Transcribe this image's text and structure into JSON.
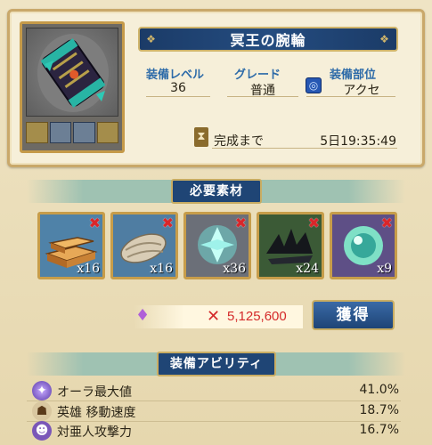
{
  "item": {
    "name": "冥王の腕輪",
    "stats": {
      "level_label": "装備レベル",
      "level_value": "36",
      "grade_label": "グレード",
      "grade_value": "普通",
      "slot_label": "装備部位",
      "slot_value": "アクセ"
    },
    "timer_label": "完成まで",
    "timer_value": "5日19:35:49"
  },
  "materials": {
    "title": "必要素材",
    "items": [
      {
        "icon": "gold-ingot-icon",
        "qty": "x16",
        "color": "#d28a3a"
      },
      {
        "icon": "cloth-bundle-icon",
        "qty": "x16",
        "color": "#b9ab94"
      },
      {
        "icon": "cyan-crystal-icon",
        "qty": "x36",
        "color": "#5fc0c0"
      },
      {
        "icon": "dark-feather-icon",
        "qty": "x24",
        "color": "#3a4a2c"
      },
      {
        "icon": "teal-orb-icon",
        "qty": "x9",
        "color": "#7acfb8"
      }
    ]
  },
  "cost": {
    "amount": "5,125,600",
    "button_label": "獲得"
  },
  "abilities": {
    "title": "装備アビリティ",
    "rows": [
      {
        "label": "オーラ最大値",
        "value": "41.0%"
      },
      {
        "label": "英雄 移動速度",
        "value": "18.7%"
      },
      {
        "label": "対亜人攻撃力",
        "value": "16.7%"
      }
    ]
  },
  "colors": {
    "accent_blue": "#1f4575",
    "gold_border": "#c9ad63",
    "cost_red": "#d42a2a"
  }
}
